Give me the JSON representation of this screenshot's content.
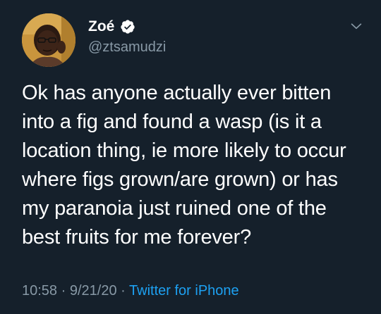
{
  "author": {
    "display_name": "Zoé",
    "handle": "@ztsamudzi",
    "verified": true,
    "avatar_icon": "profile-photo"
  },
  "tweet": {
    "lines": [
      "Ok has anyone actually ever bitten",
      "into a fig and found a wasp (is it a",
      "location thing, ie more likely to occur",
      "where figs grown/are grown) or has",
      "my paranoia just ruined one of the",
      "best fruits for me forever?"
    ]
  },
  "meta": {
    "time": "10:58",
    "date": "9/21/20",
    "separator": "·",
    "source": "Twitter for iPhone"
  },
  "colors": {
    "background": "#15202b",
    "text": "#ffffff",
    "secondary": "#8899a6",
    "accent": "#1da1f2"
  },
  "icons": {
    "verified": "verified-badge-icon",
    "menu": "chevron-down-icon"
  }
}
